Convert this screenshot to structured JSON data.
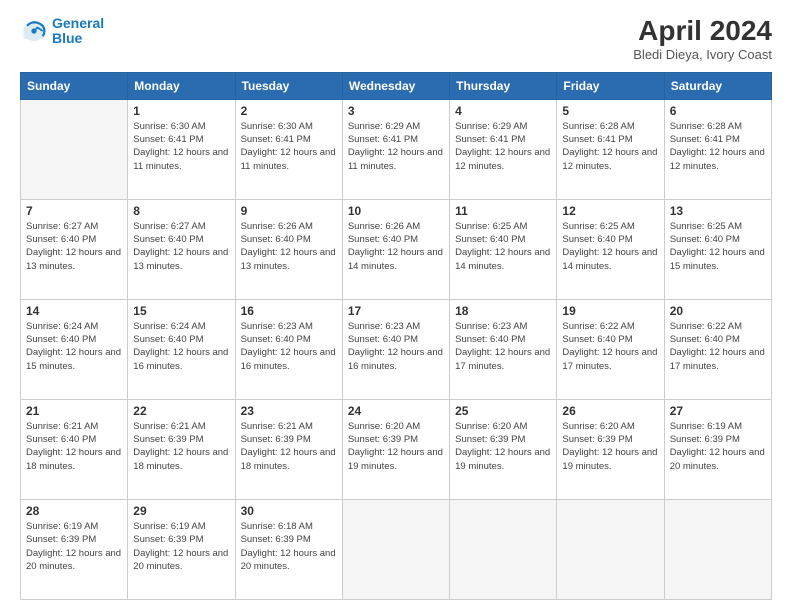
{
  "header": {
    "logo_line1": "General",
    "logo_line2": "Blue",
    "title": "April 2024",
    "subtitle": "Bledi Dieya, Ivory Coast"
  },
  "weekdays": [
    "Sunday",
    "Monday",
    "Tuesday",
    "Wednesday",
    "Thursday",
    "Friday",
    "Saturday"
  ],
  "weeks": [
    [
      {
        "day": "",
        "sunrise": "",
        "sunset": "",
        "daylight": "",
        "empty": true
      },
      {
        "day": "1",
        "sunrise": "6:30 AM",
        "sunset": "6:41 PM",
        "daylight": "12 hours and 11 minutes."
      },
      {
        "day": "2",
        "sunrise": "6:30 AM",
        "sunset": "6:41 PM",
        "daylight": "12 hours and 11 minutes."
      },
      {
        "day": "3",
        "sunrise": "6:29 AM",
        "sunset": "6:41 PM",
        "daylight": "12 hours and 11 minutes."
      },
      {
        "day": "4",
        "sunrise": "6:29 AM",
        "sunset": "6:41 PM",
        "daylight": "12 hours and 12 minutes."
      },
      {
        "day": "5",
        "sunrise": "6:28 AM",
        "sunset": "6:41 PM",
        "daylight": "12 hours and 12 minutes."
      },
      {
        "day": "6",
        "sunrise": "6:28 AM",
        "sunset": "6:41 PM",
        "daylight": "12 hours and 12 minutes."
      }
    ],
    [
      {
        "day": "7",
        "sunrise": "6:27 AM",
        "sunset": "6:40 PM",
        "daylight": "12 hours and 13 minutes."
      },
      {
        "day": "8",
        "sunrise": "6:27 AM",
        "sunset": "6:40 PM",
        "daylight": "12 hours and 13 minutes."
      },
      {
        "day": "9",
        "sunrise": "6:26 AM",
        "sunset": "6:40 PM",
        "daylight": "12 hours and 13 minutes."
      },
      {
        "day": "10",
        "sunrise": "6:26 AM",
        "sunset": "6:40 PM",
        "daylight": "12 hours and 14 minutes."
      },
      {
        "day": "11",
        "sunrise": "6:25 AM",
        "sunset": "6:40 PM",
        "daylight": "12 hours and 14 minutes."
      },
      {
        "day": "12",
        "sunrise": "6:25 AM",
        "sunset": "6:40 PM",
        "daylight": "12 hours and 14 minutes."
      },
      {
        "day": "13",
        "sunrise": "6:25 AM",
        "sunset": "6:40 PM",
        "daylight": "12 hours and 15 minutes."
      }
    ],
    [
      {
        "day": "14",
        "sunrise": "6:24 AM",
        "sunset": "6:40 PM",
        "daylight": "12 hours and 15 minutes."
      },
      {
        "day": "15",
        "sunrise": "6:24 AM",
        "sunset": "6:40 PM",
        "daylight": "12 hours and 16 minutes."
      },
      {
        "day": "16",
        "sunrise": "6:23 AM",
        "sunset": "6:40 PM",
        "daylight": "12 hours and 16 minutes."
      },
      {
        "day": "17",
        "sunrise": "6:23 AM",
        "sunset": "6:40 PM",
        "daylight": "12 hours and 16 minutes."
      },
      {
        "day": "18",
        "sunrise": "6:23 AM",
        "sunset": "6:40 PM",
        "daylight": "12 hours and 17 minutes."
      },
      {
        "day": "19",
        "sunrise": "6:22 AM",
        "sunset": "6:40 PM",
        "daylight": "12 hours and 17 minutes."
      },
      {
        "day": "20",
        "sunrise": "6:22 AM",
        "sunset": "6:40 PM",
        "daylight": "12 hours and 17 minutes."
      }
    ],
    [
      {
        "day": "21",
        "sunrise": "6:21 AM",
        "sunset": "6:40 PM",
        "daylight": "12 hours and 18 minutes."
      },
      {
        "day": "22",
        "sunrise": "6:21 AM",
        "sunset": "6:39 PM",
        "daylight": "12 hours and 18 minutes."
      },
      {
        "day": "23",
        "sunrise": "6:21 AM",
        "sunset": "6:39 PM",
        "daylight": "12 hours and 18 minutes."
      },
      {
        "day": "24",
        "sunrise": "6:20 AM",
        "sunset": "6:39 PM",
        "daylight": "12 hours and 19 minutes."
      },
      {
        "day": "25",
        "sunrise": "6:20 AM",
        "sunset": "6:39 PM",
        "daylight": "12 hours and 19 minutes."
      },
      {
        "day": "26",
        "sunrise": "6:20 AM",
        "sunset": "6:39 PM",
        "daylight": "12 hours and 19 minutes."
      },
      {
        "day": "27",
        "sunrise": "6:19 AM",
        "sunset": "6:39 PM",
        "daylight": "12 hours and 20 minutes."
      }
    ],
    [
      {
        "day": "28",
        "sunrise": "6:19 AM",
        "sunset": "6:39 PM",
        "daylight": "12 hours and 20 minutes."
      },
      {
        "day": "29",
        "sunrise": "6:19 AM",
        "sunset": "6:39 PM",
        "daylight": "12 hours and 20 minutes."
      },
      {
        "day": "30",
        "sunrise": "6:18 AM",
        "sunset": "6:39 PM",
        "daylight": "12 hours and 20 minutes."
      },
      {
        "day": "",
        "sunrise": "",
        "sunset": "",
        "daylight": "",
        "empty": true
      },
      {
        "day": "",
        "sunrise": "",
        "sunset": "",
        "daylight": "",
        "empty": true
      },
      {
        "day": "",
        "sunrise": "",
        "sunset": "",
        "daylight": "",
        "empty": true
      },
      {
        "day": "",
        "sunrise": "",
        "sunset": "",
        "daylight": "",
        "empty": true
      }
    ]
  ],
  "labels": {
    "sunrise": "Sunrise:",
    "sunset": "Sunset:",
    "daylight": "Daylight:"
  }
}
